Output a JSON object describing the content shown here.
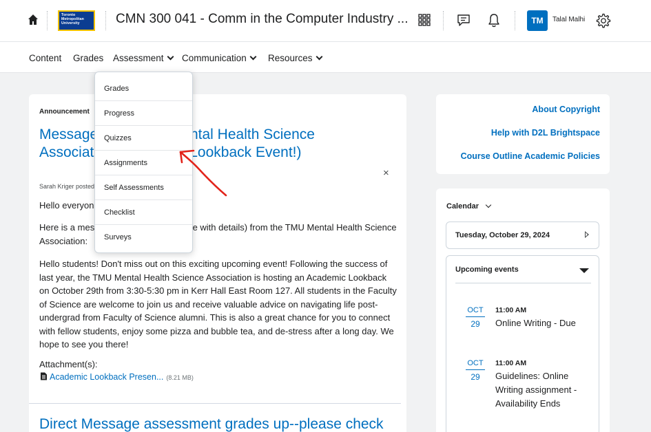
{
  "header": {
    "logo_text": [
      "Toronto",
      "Metropolitan",
      "University"
    ],
    "course_title": "CMN 300 041 - Comm in the Computer Industry ...",
    "avatar_initials": "TM",
    "user_name": "Talal Malhi"
  },
  "nav": {
    "items": [
      "Content",
      "Grades",
      "Assessment",
      "Communication",
      "Resources"
    ]
  },
  "assessment_menu": {
    "items": [
      "Grades",
      "Progress",
      "Quizzes",
      "Assignments",
      "Self Assessments",
      "Checklist",
      "Surveys"
    ]
  },
  "announcement": {
    "heading": "Announcement",
    "title": "Message from TMU Mental Health Science Association (Academic Lookback Event!)",
    "close_label": "×",
    "posted_by": "Sarah Kriger posted on Oct 22, 2024 2:33 PM",
    "greeting": "Hello everyone,",
    "intro": "Here is a message (and an attached file with details) from the TMU Mental Health Science Association:",
    "body": "Hello students! Don't miss out on this exciting upcoming event! Following the success of last year, the TMU Mental Health Science Association is hosting an Academic Lookback on October 29th from 3:30-5:30 pm in Kerr Hall East Room 127. All students in the Faculty of Science are welcome to join us and receive valuable advice on navigating life post-undergrad from Faculty of Science alumni. This is also a great chance for you to connect with fellow students, enjoy some pizza and bubble tea, and de-stress after a long day. We hope to see you there!",
    "attachments_label": "Attachment(s):",
    "attachment_name": "Academic Lookback Presen...",
    "attachment_size": "(8.21 MB)",
    "next_title": "Direct Message assessment grades up--please check"
  },
  "links": {
    "items": [
      "About Copyright",
      "Help with D2L Brightspace",
      "Course Outline Academic Policies"
    ]
  },
  "calendar": {
    "label": "Calendar",
    "date": "Tuesday, October 29, 2024",
    "upcoming_label": "Upcoming events",
    "events": [
      {
        "month": "OCT",
        "day": "29",
        "time": "11:00 AM",
        "title": "Online Writing - Due"
      },
      {
        "month": "OCT",
        "day": "29",
        "time": "11:00 AM",
        "title": "Guidelines: Online Writing assignment - Availability Ends"
      }
    ]
  },
  "colors": {
    "accent": "#006fbf",
    "annotation_arrow": "#e2231a",
    "logo_bg": "#0b3d91",
    "logo_border": "#f2c200"
  },
  "icons": [
    "home-icon",
    "waffle-grid-icon",
    "chat-icon",
    "bell-icon",
    "gear-icon",
    "file-icon",
    "chevron-down-icon",
    "close-icon",
    "next-arrow-icon",
    "caret-down-icon"
  ]
}
